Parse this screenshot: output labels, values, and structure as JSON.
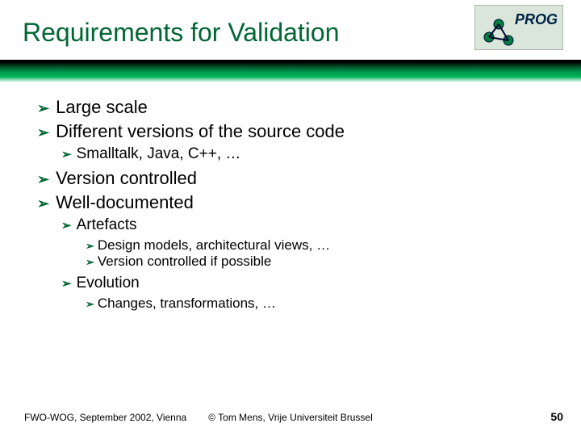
{
  "title": "Requirements for Validation",
  "logo_text": "PROG",
  "bullets": {
    "b1": "Large scale",
    "b2": "Different versions of the source code",
    "b2_1": "Smalltalk, Java, C++, …",
    "b3": "Version controlled",
    "b4": "Well-documented",
    "b4_1": "Artefacts",
    "b4_1_1": "Design models, architectural views, …",
    "b4_1_2": "Version controlled if possible",
    "b4_2": "Evolution",
    "b4_2_1": "Changes, transformations, …"
  },
  "footer": {
    "left": "FWO-WOG, September 2002, Vienna",
    "center": "© Tom Mens, Vrije Universiteit Brussel",
    "page": "50"
  }
}
